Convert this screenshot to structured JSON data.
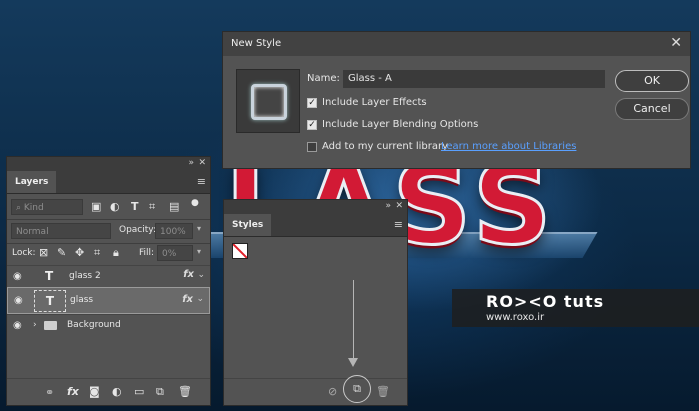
{
  "dialog": {
    "title": "New Style",
    "name_label": "Name:",
    "name_value": "Glass - A",
    "ok_label": "OK",
    "cancel_label": "Cancel",
    "include_effects": "Include Layer Effects",
    "include_blending": "Include Layer Blending Options",
    "add_library": "Add to my current library",
    "learn_more": "Learn more about Libraries"
  },
  "layers_panel": {
    "tab": "Layers",
    "kind": "Kind",
    "blend_mode": "Normal",
    "opacity_label": "Opacity:",
    "opacity_value": "100%",
    "lock_label": "Lock:",
    "fill_label": "Fill:",
    "fill_value": "0%",
    "layers": [
      {
        "name": "glass 2",
        "type": "text",
        "fx": "fx"
      },
      {
        "name": "glass",
        "type": "text",
        "fx": "fx",
        "selected": true
      },
      {
        "name": "Background",
        "type": "group"
      }
    ]
  },
  "styles_panel": {
    "tab": "Styles"
  },
  "artwork": {
    "text": "LASS"
  },
  "watermark": {
    "brand": "RO><O tuts",
    "url": "www.roxo.ir"
  },
  "colors": {
    "panel_bg": "#535353",
    "link": "#5aa0ff",
    "accent_red": "#d21a35"
  }
}
